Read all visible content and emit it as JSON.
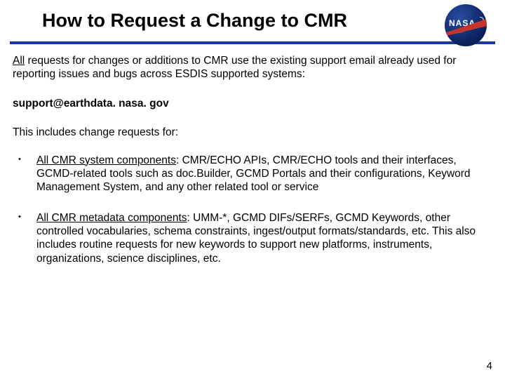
{
  "header": {
    "title": "How to Request a Change to CMR",
    "logo_text": "NASA"
  },
  "intro": {
    "underlined": "All",
    "rest": " requests for changes or additions to CMR use the existing support email already used for reporting issues and bugs across ESDIS supported systems:"
  },
  "email": "support@earthdata. nasa. gov",
  "includes": "This includes change requests for:",
  "bullets": [
    {
      "lead": "All CMR system components",
      "rest": ":  CMR/ECHO APIs, CMR/ECHO tools and their interfaces, GCMD-related tools such as doc.Builder, GCMD Portals and their configurations, Keyword Management System, and any other related tool or service"
    },
    {
      "lead": "All CMR metadata components",
      "rest": ": UMM-*, GCMD DIFs/SERFs, GCMD Keywords, other controlled vocabularies, schema constraints, ingest/output formats/standards, etc. This also includes routine requests for new keywords to support new platforms, instruments, organizations, science disciplines, etc."
    }
  ],
  "page_number": "4"
}
